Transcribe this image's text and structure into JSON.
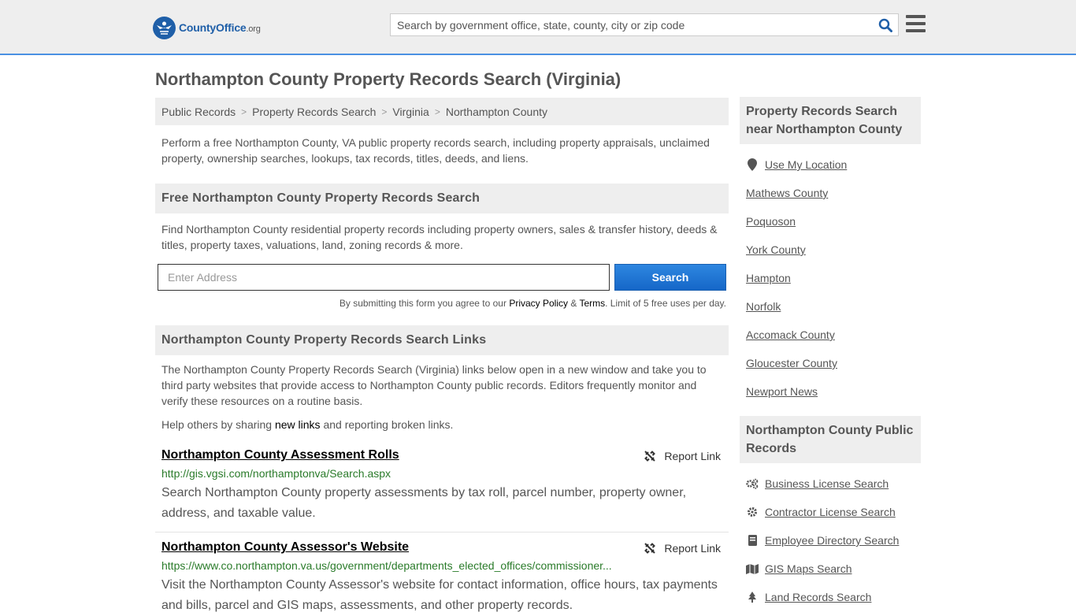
{
  "header": {
    "logo_brand": "CountyOffice",
    "logo_tld": ".org",
    "search_placeholder": "Search by government office, state, county, city or zip code"
  },
  "page_title": "Northampton County Property Records Search (Virginia)",
  "breadcrumb": [
    "Public Records",
    "Property Records Search",
    "Virginia",
    "Northampton County"
  ],
  "intro": "Perform a free Northampton County, VA public property records search, including property appraisals, unclaimed property, ownership searches, lookups, tax records, titles, deeds, and liens.",
  "free_search": {
    "heading": "Free Northampton County Property Records Search",
    "description": "Find Northampton County residential property records including property owners, sales & transfer history, deeds & titles, property taxes, valuations, land, zoning records & more.",
    "address_placeholder": "Enter Address",
    "button_label": "Search",
    "disclaimer_prefix": "By submitting this form you agree to our ",
    "privacy_label": "Privacy Policy",
    "amp": " & ",
    "terms_label": "Terms",
    "disclaimer_suffix": ". Limit of 5 free uses per day."
  },
  "links_section": {
    "heading": "Northampton County Property Records Search Links",
    "description": "The Northampton County Property Records Search (Virginia) links below open in a new window and take you to third party websites that provide access to Northampton County public records. Editors frequently monitor and verify these resources on a routine basis.",
    "help_prefix": "Help others by sharing ",
    "help_link": "new links",
    "help_suffix": " and reporting broken links.",
    "report_label": "Report Link",
    "items": [
      {
        "title": "Northampton County Assessment Rolls",
        "url": "http://gis.vgsi.com/northamptonva/Search.aspx",
        "desc": "Search Northampton County property assessments by tax roll, parcel number, property owner, address, and taxable value."
      },
      {
        "title": "Northampton County Assessor's Website",
        "url": "https://www.co.northampton.va.us/government/departments_elected_offices/commissioner...",
        "desc": "Visit the Northampton County Assessor's website for contact information, office hours, tax payments and bills, parcel and GIS maps, assessments, and other property records."
      }
    ]
  },
  "sidebar": {
    "nearby_heading": "Property Records Search near Northampton County",
    "nearby": [
      {
        "label": "Use My Location",
        "icon": "location-pin-icon"
      },
      {
        "label": "Mathews County"
      },
      {
        "label": "Poquoson"
      },
      {
        "label": "York County"
      },
      {
        "label": "Hampton"
      },
      {
        "label": "Norfolk"
      },
      {
        "label": "Accomack County"
      },
      {
        "label": "Gloucester County"
      },
      {
        "label": "Newport News"
      }
    ],
    "public_heading": "Northampton County Public Records",
    "public": [
      {
        "label": "Business License Search",
        "icon": "gears-icon"
      },
      {
        "label": "Contractor License Search",
        "icon": "gear-icon"
      },
      {
        "label": "Employee Directory Search",
        "icon": "book-icon"
      },
      {
        "label": "GIS Maps Search",
        "icon": "map-icon"
      },
      {
        "label": "Land Records Search",
        "icon": "tree-icon"
      }
    ]
  }
}
